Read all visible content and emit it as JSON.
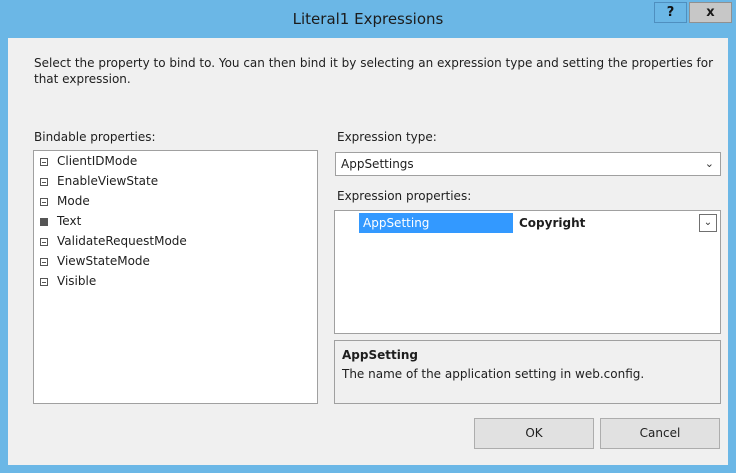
{
  "window": {
    "title": "Literal1 Expressions",
    "help_label": "?",
    "close_label": "x"
  },
  "intro_text": "Select the property to bind to.  You can then bind it by selecting an expression type and setting the properties for that expression.",
  "bindable": {
    "label": "Bindable properties:",
    "items": [
      {
        "label": "ClientIDMode",
        "bound": false
      },
      {
        "label": "EnableViewState",
        "bound": false
      },
      {
        "label": "Mode",
        "bound": false
      },
      {
        "label": "Text",
        "bound": true
      },
      {
        "label": "ValidateRequestMode",
        "bound": false
      },
      {
        "label": "ViewStateMode",
        "bound": false
      },
      {
        "label": "Visible",
        "bound": false
      }
    ]
  },
  "expression_type": {
    "label": "Expression type:",
    "value": "AppSettings"
  },
  "expression_properties": {
    "label": "Expression properties:",
    "rows": [
      {
        "name": "AppSetting",
        "value": "Copyright"
      }
    ]
  },
  "description": {
    "title": "AppSetting",
    "text": "The name of the application setting in web.config."
  },
  "buttons": {
    "ok": "OK",
    "cancel": "Cancel"
  },
  "colors": {
    "title_bar": "#6bb7e6",
    "selection": "#3399ff",
    "close_button": "#c7c7c7",
    "dialog_bg": "#f0f0f0"
  },
  "icons": {
    "property": "property-icon",
    "dropdown": "chevron-down-icon"
  }
}
